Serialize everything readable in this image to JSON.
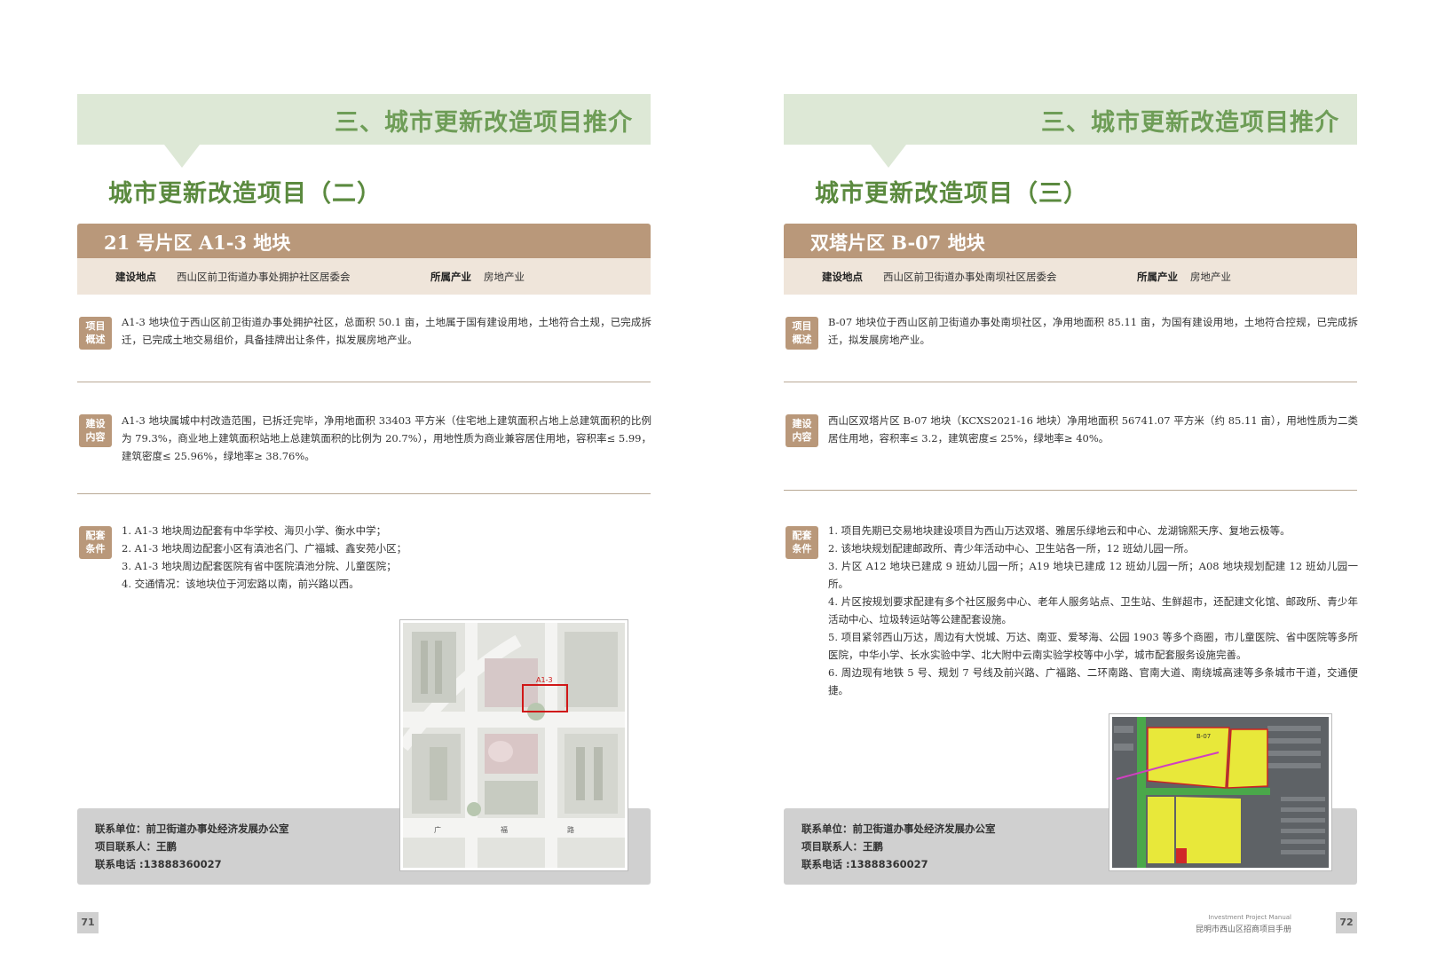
{
  "header": {
    "section_title": "三、城市更新改造项目推介"
  },
  "left": {
    "subtitle": "城市更新改造项目（二）",
    "plot_title": "21 号片区 A1-3 地块",
    "location_label": "建设地点",
    "location_value": "西山区前卫街道办事处拥护社区居委会",
    "industry_label": "所属产业",
    "industry_value": "房地产业",
    "tag_overview": [
      "项目",
      "概述"
    ],
    "overview": "A1-3 地块位于西山区前卫街道办事处拥护社区，总面积 50.1 亩，土地属于国有建设用地，土地符合土规，已完成拆迁，已完成土地交易组价，具备挂牌出让条件，拟发展房地产业。",
    "tag_content": [
      "建设",
      "内容"
    ],
    "content": "A1-3 地块属城中村改造范围，已拆迁完毕，净用地面积 33403 平方米（住宅地上建筑面积占地上总建筑面积的比例为 79.3%，商业地上建筑面积站地上总建筑面积的比例为 20.7%），用地性质为商业兼容居住用地，容积率≤ 5.99，建筑密度≤ 25.96%，绿地率≥ 38.76%。",
    "tag_support": [
      "配套",
      "条件"
    ],
    "support": [
      "1. A1-3 地块周边配套有中华学校、海贝小学、衡水中学；",
      "2. A1-3 地块周边配套小区有滇池名门、广福城、鑫安苑小区；",
      "3. A1-3 地块周边配套医院有省中医院滇池分院、儿童医院；",
      "4. 交通情况：该地块位于河宏路以南，前兴路以西。"
    ],
    "map_label_plot": "A1-3",
    "map_road": [
      "广",
      "福",
      "路"
    ],
    "contact_unit": "联系单位：前卫街道办事处经济发展办公室",
    "contact_person": "项目联系人：王鹏",
    "contact_phone": "联系电话 :13888360027",
    "page_number": "71"
  },
  "right": {
    "subtitle": "城市更新改造项目（三）",
    "plot_title": "双塔片区 B-07 地块",
    "location_label": "建设地点",
    "location_value": "西山区前卫街道办事处南坝社区居委会",
    "industry_label": "所属产业",
    "industry_value": "房地产业",
    "tag_overview": [
      "项目",
      "概述"
    ],
    "overview": "B-07 地块位于西山区前卫街道办事处南坝社区，净用地面积 85.11 亩，为国有建设用地，土地符合控规，已完成拆迁，拟发展房地产业。",
    "tag_content": [
      "建设",
      "内容"
    ],
    "content": "西山区双塔片区 B-07 地块（KCXS2021-16 地块）净用地面积 56741.07 平方米（约 85.11 亩），用地性质为二类居住用地，容积率≤ 3.2，建筑密度≤ 25%，绿地率≥ 40%。",
    "tag_support": [
      "配套",
      "条件"
    ],
    "support": [
      "1. 项目先期已交易地块建设项目为西山万达双塔、雅居乐绿地云和中心、龙湖锦熙天序、复地云极等。",
      "2. 该地块规划配建邮政所、青少年活动中心、卫生站各一所，12 班幼儿园一所。",
      "3. 片区 A12 地块已建成 9 班幼儿园一所；A19 地块已建成 12 班幼儿园一所；A08 地块规划配建 12 班幼儿园一所。",
      "4. 片区按规划要求配建有多个社区服务中心、老年人服务站点、卫生站、生鲜超市，还配建文化馆、邮政所、青少年活动中心、垃圾转运站等公建配套设施。",
      "5. 项目紧邻西山万达，周边有大悦城、万达、南亚、爱琴海、公园 1903 等多个商圈，市儿童医院、省中医院等多所医院，中华小学、长水实验中学、北大附中云南实验学校等中小学，城市配套服务设施完善。",
      "6. 周边现有地铁 5 号、规划 7 号线及前兴路、广福路、二环南路、官南大道、南绕城高速等多条城市干道，交通便捷。"
    ],
    "map_label_plot": "B-07",
    "contact_unit": "联系单位：前卫街道办事处经济发展办公室",
    "contact_person": "项目联系人：王鹏",
    "contact_phone": "联系电话 :13888360027",
    "page_number": "72",
    "manual_en": "Investment Project Manual",
    "manual_cn": "昆明市西山区招商项目手册"
  }
}
